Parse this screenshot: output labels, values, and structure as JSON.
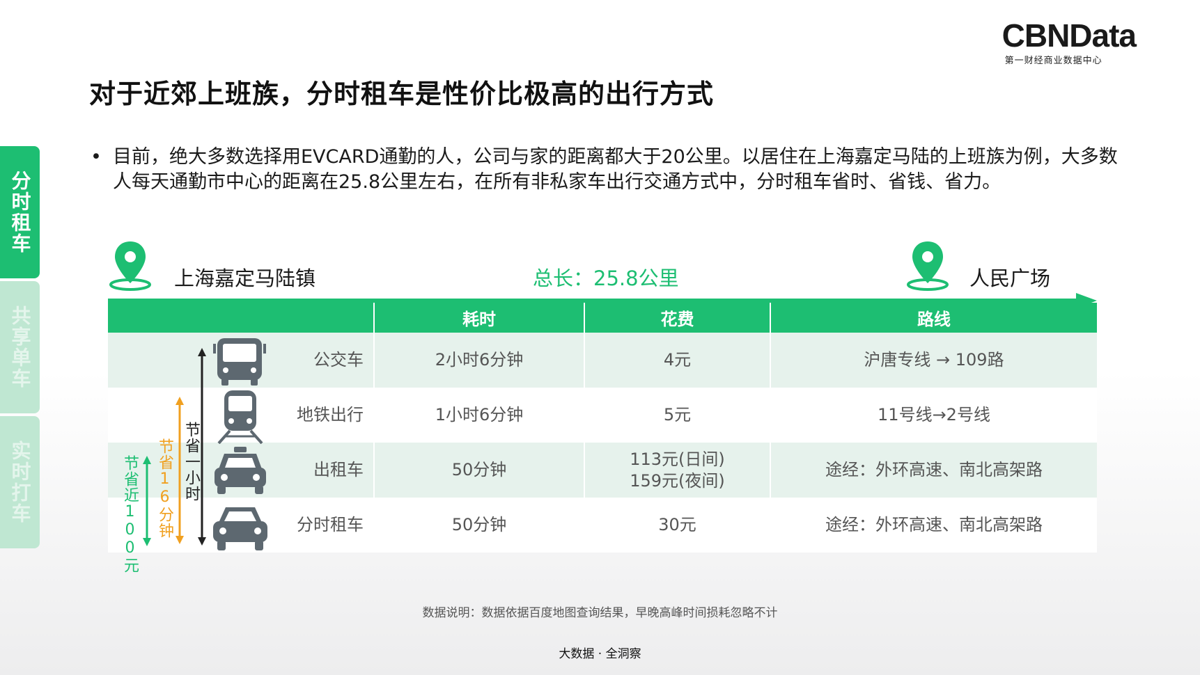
{
  "logo": {
    "main": "CBNData",
    "sub": "第一财经商业数据中心"
  },
  "title": "对于近郊上班族，分时租车是性价比极高的出行方式",
  "side_tabs": [
    {
      "label": "分时租车",
      "active": true
    },
    {
      "label": "共享单车",
      "active": false
    },
    {
      "label": "实时打车",
      "active": false
    }
  ],
  "bullet": {
    "dot": "•",
    "text": "目前，绝大多数选择用EVCARD通勤的人，公司与家的距离都大于20公里。以居住在上海嘉定马陆的上班族为例，大多数人每天通勤市中心的距离在25.8公里左右，在所有非私家车出行交通方式中，分时租车省时、省钱、省力。"
  },
  "route": {
    "start": "上海嘉定马陆镇",
    "end": "人民广场",
    "total": "总长：25.8公里"
  },
  "table": {
    "headers": [
      "",
      "耗时",
      "花费",
      "路线"
    ],
    "rows": [
      {
        "mode": "公交车",
        "time": "2小时6分钟",
        "cost": "4元",
        "route": "沪唐专线 → 109路",
        "icon": "bus-icon"
      },
      {
        "mode": "地铁出行",
        "time": "1小时6分钟",
        "cost": "5元",
        "route": "11号线→2号线",
        "icon": "subway-icon"
      },
      {
        "mode": "出租车",
        "time": "50分钟",
        "cost": "113元(日间)\n159元(夜间)",
        "route": "途经：外环高速、南北高架路",
        "icon": "taxi-icon"
      },
      {
        "mode": "分时租车",
        "time": "50分钟",
        "cost": "30元",
        "route": "途经：外环高速、南北高架路",
        "icon": "car-icon"
      }
    ]
  },
  "savings": [
    {
      "label": "节省近100元",
      "color": "#1dbe72"
    },
    {
      "label": "节省16分钟",
      "color": "#f0a020"
    },
    {
      "label": "节省一小时",
      "color": "#222222"
    }
  ],
  "colors": {
    "accent": "#1dbe72",
    "shade": "#e6f2ec",
    "orange": "#f0a020"
  },
  "note": "数据说明：数据依据百度地图查询结果，早晚高峰时间损耗忽略不计",
  "footer": "大数据 · 全洞察"
}
